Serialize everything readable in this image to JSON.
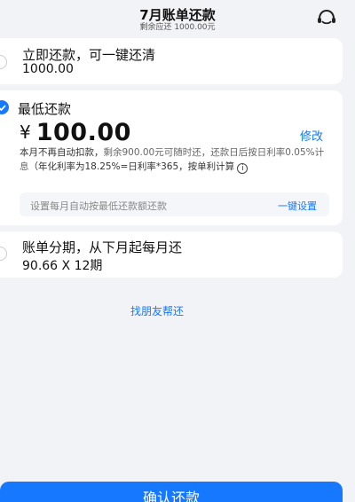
{
  "header": {
    "title": "7月账单还款",
    "subtitle": "剩余应还 1000.00元"
  },
  "icons": {
    "service": "customer-service-icon",
    "check": "check-icon",
    "info": "info-icon"
  },
  "options": {
    "full": {
      "title": "立即还款，可一键还清",
      "amount": "1000.00",
      "selected": false
    },
    "minimum": {
      "title": "最低还款",
      "currency": "¥",
      "amount": "100.00",
      "modify_label": "修改",
      "desc_main": "本月不再自动扣款，",
      "desc_muted": "剩余900.00元可随时还，还款日后按日利率0.05%计息",
      "desc_rate": "（年化利率为18.25%=日利率*365，按单利计算",
      "info_glyph": "i",
      "auto_label": "设置每月自动按最低还款额还款",
      "auto_link": "一键设置",
      "selected": true
    },
    "installment": {
      "title": "账单分期，从下月起每月还",
      "amount": "90.66 X 12期",
      "selected": false
    }
  },
  "friend_link": "找朋友帮还",
  "confirm_button": "确认还款",
  "colors": {
    "accent": "#1677ff",
    "background": "#f2f3f7",
    "card": "#ffffff"
  }
}
